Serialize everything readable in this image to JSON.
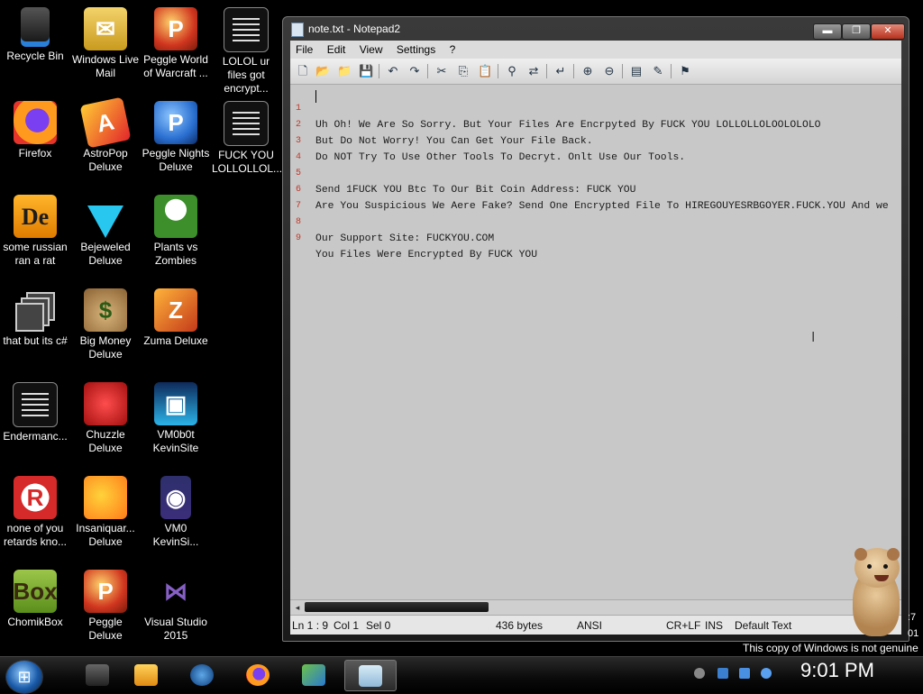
{
  "desktop": {
    "icons": [
      {
        "label": "Recycle Bin"
      },
      {
        "label": "Windows Live Mail"
      },
      {
        "label": "Peggle World of Warcraft ..."
      },
      {
        "label": "LOLOL ur files got encrypt..."
      },
      {
        "label": "Firefox"
      },
      {
        "label": "AstroPop Deluxe"
      },
      {
        "label": "Peggle Nights Deluxe"
      },
      {
        "label": "FUCK YOU LOLLOLLOL..."
      },
      {
        "label": "some russian ran a rat"
      },
      {
        "label": "Bejeweled Deluxe"
      },
      {
        "label": "Plants vs Zombies"
      },
      {
        "label": "that but its c#"
      },
      {
        "label": "Big Money Deluxe"
      },
      {
        "label": "Zuma Deluxe"
      },
      {
        "label": "Endermanc..."
      },
      {
        "label": "Chuzzle Deluxe"
      },
      {
        "label": "VM0b0t KevinSite"
      },
      {
        "label": "none of you retards kno..."
      },
      {
        "label": "Insaniquar... Deluxe"
      },
      {
        "label": "VM0 KevinSi..."
      },
      {
        "label": "ChomikBox"
      },
      {
        "label": "Peggle Deluxe"
      },
      {
        "label": "Visual Studio 2015"
      }
    ]
  },
  "window": {
    "title": "note.txt - Notepad2",
    "buttons": {
      "minimize": "▬",
      "maximize": "❐",
      "close": "✕"
    }
  },
  "menu": [
    "File",
    "Edit",
    "View",
    "Settings",
    "?"
  ],
  "toolbar_icons": [
    "new-icon",
    "open-icon",
    "browse-icon",
    "save-icon",
    "undo-icon",
    "redo-icon",
    "cut-icon",
    "copy-icon",
    "paste-icon",
    "find-icon",
    "replace-icon",
    "word-wrap-icon",
    "zoom-in-icon",
    "zoom-out-icon",
    "scheme-icon",
    "customize-icon",
    "settings-icon"
  ],
  "editor": {
    "lines": [
      {
        "n": "1",
        "text": "Uh Oh! We Are So Sorry. But Your Files Are Encrpyted By FUCK YOU LOLLOLLOLOOLOLOLO"
      },
      {
        "n": "2",
        "text": "But Do Not Worry! You Can Get Your File Back."
      },
      {
        "n": "3",
        "text": "Do NOT Try To Use Other Tools To Decryt. Onlt Use Our Tools."
      },
      {
        "n": "4",
        "text": ""
      },
      {
        "n": "5",
        "text": "Send 1FUCK YOU Btc To Our Bit Coin Address: FUCK YOU"
      },
      {
        "n": "6",
        "text": "Are You Suspicious We Aere Fake? Send One Encrypted File To HIREGOUYESRBGOYER.FUCK.YOU And we"
      },
      {
        "n": "7",
        "text": ""
      },
      {
        "n": "8",
        "text": "Our Support Site: FUCKYOU.COM"
      },
      {
        "n": "9",
        "text": "You Files Were Encrypted By FUCK YOU"
      }
    ]
  },
  "status": {
    "position": "Ln 1 : 9",
    "col": "Col 1",
    "sel": "Sel 0",
    "size": "436 bytes",
    "encoding": "ANSI",
    "eol": "CR+LF",
    "ins": "INS",
    "scheme": "Default Text"
  },
  "overlay": {
    "side_text_1": ":7",
    "side_text_2": "01",
    "genuine": "This copy of Windows is not genuine"
  },
  "taskbar": {
    "clock": "9:01 PM",
    "colors": {
      "accent": "#1a5aa8"
    }
  }
}
